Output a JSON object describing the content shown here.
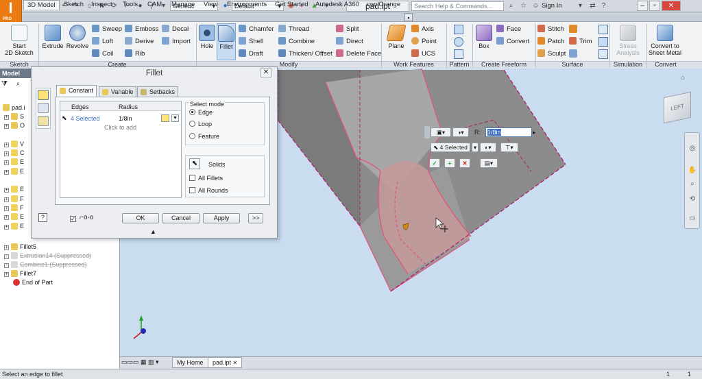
{
  "app": {
    "logo_text": "I",
    "logo_sub": "PRO"
  },
  "titlebar": {
    "style_select": "Generic",
    "appearance_select": "Default",
    "document_title": "pad.ipt",
    "search_placeholder": "Search Help & Commands...",
    "sign_in": "Sign In"
  },
  "ribbon_tabs": [
    "3D Model",
    "Sketch",
    "Inspect",
    "Tools",
    "CAM",
    "Manage",
    "View",
    "Environments",
    "Get Started",
    "Autodesk A360",
    "coolOrange"
  ],
  "ribbon": {
    "sketch": {
      "start_line1": "Start",
      "start_line2": "2D Sketch",
      "panel": "Sketch"
    },
    "create": {
      "extrude": "Extrude",
      "revolve": "Revolve",
      "sweep": "Sweep",
      "loft": "Loft",
      "coil": "Coil",
      "emboss": "Emboss",
      "derive": "Derive",
      "rib": "Rib",
      "decal": "Decal",
      "import": "Import",
      "panel": "Create"
    },
    "modify": {
      "hole": "Hole",
      "fillet": "Fillet",
      "chamfer": "Chamfer",
      "shell": "Shell",
      "draft": "Draft",
      "thread": "Thread",
      "combine": "Combine",
      "thicken": "Thicken/ Offset",
      "split": "Split",
      "direct": "Direct",
      "delete_face": "Delete Face",
      "panel": "Modify"
    },
    "work": {
      "plane": "Plane",
      "axis": "Axis",
      "point": "Point",
      "ucs": "UCS",
      "panel": "Work Features"
    },
    "pattern": {
      "panel": "Pattern"
    },
    "freeform": {
      "box": "Box",
      "face": "Face",
      "convert": "Convert",
      "panel": "Create Freeform"
    },
    "surface": {
      "stitch": "Stitch",
      "patch": "Patch",
      "sculpt": "Sculpt",
      "trim": "Trim",
      "panel": "Surface"
    },
    "simulation": {
      "stress_line1": "Stress",
      "stress_line2": "Analysis",
      "panel": "Simulation"
    },
    "convert": {
      "sheet_line1": "Convert to",
      "sheet_line2": "Sheet Metal",
      "panel": "Convert"
    }
  },
  "browser": {
    "header": "Model",
    "root": "pad.i",
    "items": [
      {
        "label": "S",
        "icon": "folder"
      },
      {
        "label": "O",
        "icon": "folder"
      },
      {
        "label": "V",
        "icon": "feature"
      },
      {
        "label": "C",
        "icon": "feature"
      },
      {
        "label": "E",
        "icon": "feature"
      },
      {
        "label": "E",
        "icon": "feature"
      },
      {
        "label": "E",
        "icon": "feature"
      },
      {
        "label": "F",
        "icon": "feature"
      },
      {
        "label": "F",
        "icon": "feature"
      },
      {
        "label": "E",
        "icon": "feature"
      },
      {
        "label": "E",
        "icon": "feature"
      }
    ],
    "tail_items": [
      {
        "label": "Fillet5",
        "suppressed": false
      },
      {
        "label": "Extrusion14 (Suppressed)",
        "suppressed": true
      },
      {
        "label": "Combine1 (Suppressed)",
        "suppressed": true
      },
      {
        "label": "Fillet7",
        "suppressed": false
      },
      {
        "label": "End of Part",
        "suppressed": false
      }
    ]
  },
  "bottom_tabs": {
    "home": "My Home",
    "doc": "pad.ipt"
  },
  "status": {
    "message": "Select an edge to fillet",
    "count1": "1",
    "count2": "1"
  },
  "dialog": {
    "title": "Fillet",
    "tabs": [
      "Constant",
      "Variable",
      "Setbacks"
    ],
    "table": {
      "col_edges": "Edges",
      "col_radius": "Radius",
      "row_edges": "4 Selected",
      "row_radius": "1/8in",
      "add_hint": "Click to add"
    },
    "select_mode": {
      "label": "Select mode",
      "options": [
        "Edge",
        "Loop",
        "Feature"
      ],
      "selected": "Edge"
    },
    "solids_label": "Solids",
    "all_fillets": "All Fillets",
    "all_rounds": "All Rounds",
    "buttons": {
      "ok": "OK",
      "cancel": "Cancel",
      "apply": "Apply",
      "more": ">>"
    }
  },
  "minitoolbar": {
    "radius_label": "R:",
    "radius_value": "1/8in",
    "selected": "4 Selected"
  },
  "viewcube": {
    "face": "LEFT"
  },
  "colors": {
    "accent": "#ea7a12",
    "selection": "#e0557a",
    "background": "#c9dcf0",
    "part": "#9c9c9c"
  }
}
